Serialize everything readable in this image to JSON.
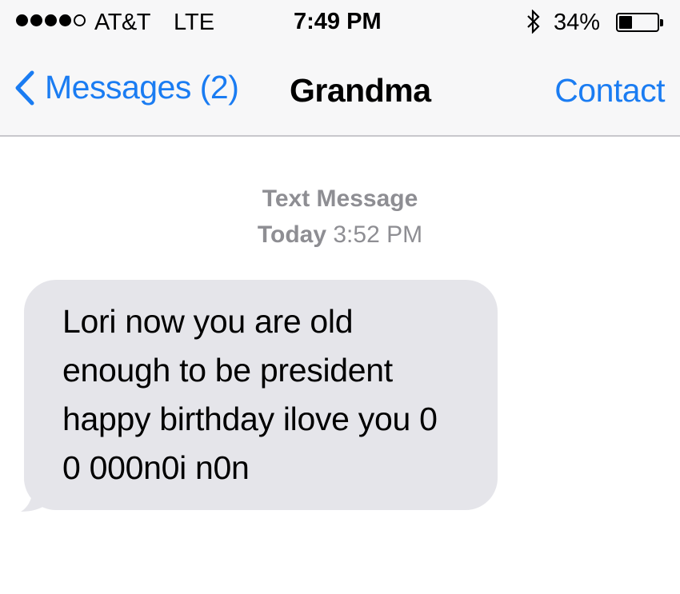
{
  "status_bar": {
    "signal_filled": 4,
    "signal_total": 5,
    "carrier": "AT&T",
    "network": "LTE",
    "time": "7:49 PM",
    "bluetooth_icon": "bluetooth-icon",
    "battery_percent": "34%",
    "battery_level": 0.34
  },
  "nav": {
    "back_icon": "chevron-left-icon",
    "back_label": "Messages (2)",
    "title": "Grandma",
    "contact_label": "Contact"
  },
  "conversation": {
    "service_label": "Text Message",
    "day_label": "Today",
    "time_label": "3:52 PM",
    "messages": [
      {
        "direction": "incoming",
        "text": "Lori  now you are old enough to be president happy birthday  ilove you  0 0 000n0i n0n"
      }
    ]
  },
  "colors": {
    "accent": "#1a7cf2",
    "header_bg": "#f7f7f8",
    "incoming_bubble": "#e5e5ea",
    "timestamp_gray": "#8e8e93"
  }
}
